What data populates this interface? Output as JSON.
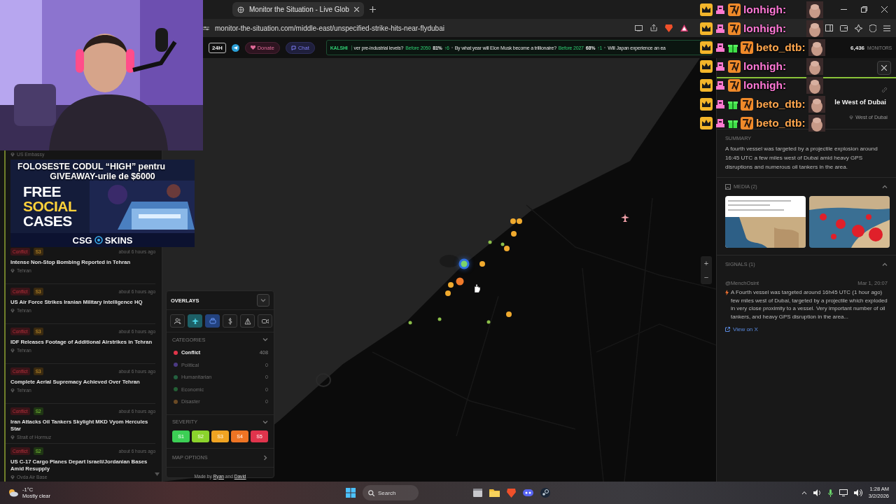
{
  "ad": {
    "line1": "FOLOSESTE CODUL “HIGH” pentru",
    "line2": "GIVEAWAY-urile de $6000",
    "headline": [
      "FREE",
      "SOCIAL",
      "CASES"
    ],
    "brand": [
      "CSG",
      "SKINS"
    ]
  },
  "chat": [
    {
      "user": "lonhigh:",
      "color": "#ff78d6",
      "gift": false
    },
    {
      "user": "lonhigh:",
      "color": "#ff78d6",
      "gift": false
    },
    {
      "user": "beto_dtb:",
      "color": "#ffa64d",
      "gift": true
    },
    {
      "user": "lonhigh:",
      "color": "#ff78d6",
      "gift": false
    },
    {
      "user": "lonhigh:",
      "color": "#ff78d6",
      "gift": false
    },
    {
      "user": "beto_dtb:",
      "color": "#ffa64d",
      "gift": true
    },
    {
      "user": "beto_dtb:",
      "color": "#ffa64d",
      "gift": true
    }
  ],
  "browser": {
    "tab": {
      "title": "Monitor the Situation - Live Glob",
      "selected": true
    },
    "address": "monitor-the-situation.com/middle-east/unspecified-strike-hits-near-flydubai"
  },
  "header": {
    "range": "24H",
    "donate": "Donate",
    "chat": "Chat",
    "ticker": {
      "source": "KALSHI",
      "items": [
        {
          "question": "ver pre-industrial levels?",
          "when": "Before 2050",
          "percent": "81%",
          "change": "↑6"
        },
        {
          "question": "By what year will Elon Musk become a trillionaire?",
          "when": "Before 2027",
          "percent": "68%",
          "change": "↑1"
        },
        {
          "question": "Will Japan experience an ea"
        }
      ]
    },
    "monitors_count": "6,436",
    "monitors_label": "MONITORS"
  },
  "sidebar": {
    "top_location": "US Embassy",
    "stories": [
      {
        "category": "Conflict",
        "severity": "S3",
        "time": "about 6 hours ago",
        "title": "Intense Non-Stop Bombing Reported in Tehran",
        "location": "Tehran"
      },
      {
        "category": "Conflict",
        "severity": "S3",
        "time": "about 6 hours ago",
        "title": "US Air Force Strikes Iranian Military Intelligence HQ",
        "location": "Tehran"
      },
      {
        "category": "Conflict",
        "severity": "S3",
        "time": "about 6 hours ago",
        "title": "IDF Releases Footage of Additional Airstrikes in Tehran",
        "location": "Tehran"
      },
      {
        "category": "Conflict",
        "severity": "S3",
        "time": "about 6 hours ago",
        "title": "Complete Aerial Supremacy Achieved Over Tehran",
        "location": "Tehran"
      },
      {
        "category": "Conflict",
        "severity": "S2",
        "time": "about 6 hours ago",
        "title": "Iran Attacks Oil Tankers Skylight MKD Vyom Hercules Star",
        "location": "Strait of Hormuz"
      },
      {
        "category": "Conflict",
        "severity": "S2",
        "time": "about 6 hours ago",
        "title": "US C-17 Cargo Planes Depart Israeli/Jordanian Bases Amid Resupply",
        "location": "Ovda Air Base"
      }
    ]
  },
  "map": {
    "kind": "picture",
    "zoom_in": "+",
    "zoom_out": "−",
    "markers": [
      {
        "color": "#f0aa2e",
        "selected": false
      },
      {
        "color": "#f0aa2e",
        "selected": false
      },
      {
        "color": "#f0aa2e",
        "selected": false
      },
      {
        "color": "#f0aa2e",
        "selected": false
      },
      {
        "color": "#8cbf4a",
        "selected": false
      },
      {
        "color": "#8cbf4a",
        "selected": false
      },
      {
        "color": "#7bd36a",
        "selected": true
      },
      {
        "color": "#f0aa2e",
        "selected": false
      },
      {
        "color": "#f07a2a",
        "selected": false
      },
      {
        "color": "#f0aa2e",
        "selected": false
      },
      {
        "color": "#f0aa2e",
        "selected": false
      },
      {
        "color": "#f0aa2e",
        "selected": false
      },
      {
        "color": "#8cbf4a",
        "selected": false
      },
      {
        "color": "#8cbf4a",
        "selected": false
      },
      {
        "color": "#8cbf4a",
        "selected": false
      }
    ]
  },
  "overlays": {
    "title": "OVERLAYS",
    "toggles": [
      {
        "on": false
      },
      {
        "on": true,
        "color": "#1d5f66"
      },
      {
        "on": true,
        "color": "#23427e"
      },
      {
        "on": false
      },
      {
        "on": false
      },
      {
        "on": false
      }
    ],
    "categories_label": "CATEGORIES",
    "categories": [
      {
        "label": "Conflict",
        "count": "408",
        "color": "#e0354a",
        "on": true
      },
      {
        "label": "Political",
        "count": "0",
        "color": "#4b3a82",
        "on": false
      },
      {
        "label": "Humanitarian",
        "count": "0",
        "color": "#24603f",
        "on": false
      },
      {
        "label": "Economic",
        "count": "0",
        "color": "#245f35",
        "on": false
      },
      {
        "label": "Disaster",
        "count": "0",
        "color": "#6a4a25",
        "on": false
      }
    ],
    "severity_label": "SEVERITY",
    "severity": [
      {
        "label": "S1",
        "color": "#3ccf55"
      },
      {
        "label": "S2",
        "color": "#8bd42c"
      },
      {
        "label": "S3",
        "color": "#f0a322"
      },
      {
        "label": "S4",
        "color": "#ee7424"
      },
      {
        "label": "S5",
        "color": "#e0344c"
      }
    ],
    "map_options": "MAP OPTIONS",
    "credit": {
      "prefix": "Made by",
      "joiner": "and",
      "links": [
        "Ryan",
        "David"
      ]
    }
  },
  "detail": {
    "title": "le West of Dubai",
    "location": "West of Dubai",
    "summary_label": "SUMMARY",
    "summary": "A fourth vessel was targeted by a projectile explosion around 16:45 UTC a few miles west of Dubai amid heavy GPS disruptions and numerous oil tankers in the area.",
    "media_label": "MEDIA (2)",
    "signals_label": "SIGNALS (1)",
    "signal": {
      "author": "@MenchOsint",
      "date": "Mar 1, 20:07",
      "text": "A Fourth vessel was targeted around 16h45 UTC (1 hour ago) few miles west of Dubai, targeted by a projectile which exploded in very close proximity to a vessel. Very important number of oil tankers, and heavy GPS disruption in the area...",
      "link": "View on X"
    }
  },
  "taskbar": {
    "temp": "-1°C",
    "condition": "Mostly clear",
    "search": "Search",
    "time": "1:28 AM",
    "date": "3/2/2026"
  }
}
